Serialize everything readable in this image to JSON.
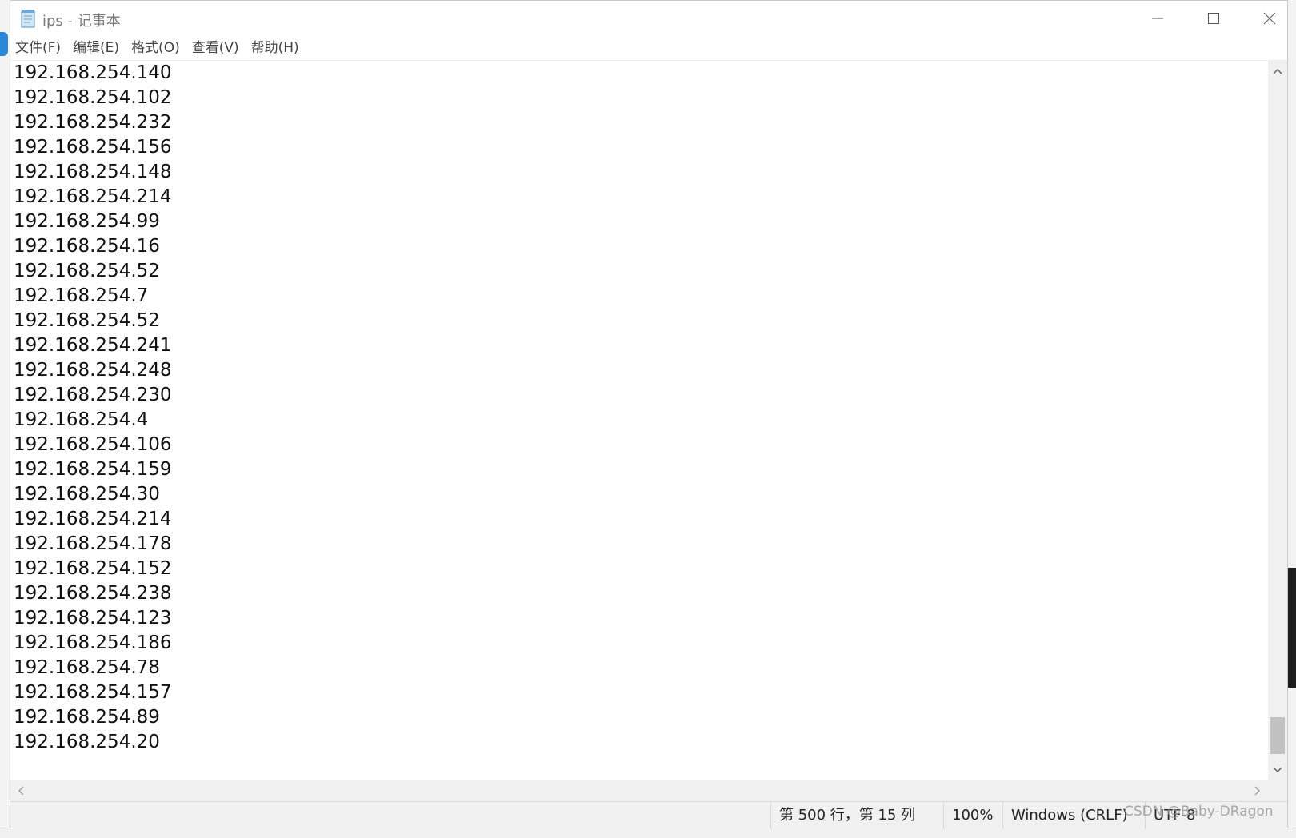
{
  "window": {
    "title": "ips - 记事本",
    "minimize_icon": "minimize-icon",
    "maximize_icon": "maximize-icon",
    "close_icon": "close-icon"
  },
  "menu": [
    {
      "label": "文件(F)"
    },
    {
      "label": "编辑(E)"
    },
    {
      "label": "格式(O)"
    },
    {
      "label": "查看(V)"
    },
    {
      "label": "帮助(H)"
    }
  ],
  "editor": {
    "lines": [
      "192.168.254.140",
      "192.168.254.102",
      "192.168.254.232",
      "192.168.254.156",
      "192.168.254.148",
      "192.168.254.214",
      "192.168.254.99",
      "192.168.254.16",
      "192.168.254.52",
      "192.168.254.7",
      "192.168.254.52",
      "192.168.254.241",
      "192.168.254.248",
      "192.168.254.230",
      "192.168.254.4",
      "192.168.254.106",
      "192.168.254.159",
      "192.168.254.30",
      "192.168.254.214",
      "192.168.254.178",
      "192.168.254.152",
      "192.168.254.238",
      "192.168.254.123",
      "192.168.254.186",
      "192.168.254.78",
      "192.168.254.157",
      "192.168.254.89",
      "192.168.254.20"
    ],
    "vertical_scroll_position": 0.95
  },
  "status": {
    "position": "第 500 行，第 15 列",
    "zoom": "100%",
    "line_ending": "Windows (CRLF)",
    "encoding": "UTF-8"
  },
  "watermark": "CSDN @Baby-DRagon"
}
